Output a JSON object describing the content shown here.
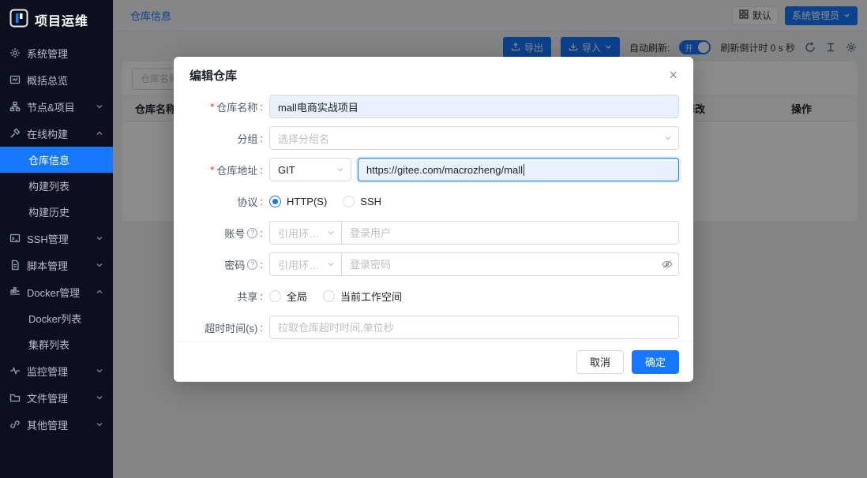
{
  "app": {
    "logo_title": "项目运维"
  },
  "sidebar": {
    "items": [
      {
        "label": "系统管理"
      },
      {
        "label": "概括总览"
      },
      {
        "label": "节点&项目"
      },
      {
        "label": "在线构建"
      },
      {
        "label": "SSH管理"
      },
      {
        "label": "脚本管理"
      },
      {
        "label": "Docker管理"
      },
      {
        "label": "监控管理"
      },
      {
        "label": "文件管理"
      },
      {
        "label": "其他管理"
      }
    ],
    "build_children": [
      {
        "label": "仓库信息"
      },
      {
        "label": "构建列表"
      },
      {
        "label": "构建历史"
      }
    ],
    "docker_children": [
      {
        "label": "Docker列表"
      },
      {
        "label": "集群列表"
      }
    ]
  },
  "header": {
    "active_tab": "仓库信息",
    "workspace_button": "默认",
    "user_button": "系统管理员"
  },
  "toolbar": {
    "export_button": "导出",
    "import_button": "导入",
    "auto_refresh_label": "自动刷新:",
    "auto_refresh_state": "开",
    "countdown_text": "刷新倒计时 0 s 秒"
  },
  "content": {
    "search_placeholder": "仓库名称",
    "table_columns": {
      "name": "仓库名称",
      "modify": "修改",
      "action": "操作"
    }
  },
  "modal": {
    "title": "编辑仓库",
    "required_mark": "*",
    "colon": ":",
    "rows": {
      "repo_name": {
        "label": "仓库名称",
        "value": "mall电商实战项目"
      },
      "group": {
        "label": "分组",
        "placeholder": "选择分组名"
      },
      "repo_url": {
        "label": "仓库地址",
        "type_value": "GIT",
        "value": "https://gitee.com/macrozheng/mall"
      },
      "protocol": {
        "label": "协议",
        "option_http": "HTTP(S)",
        "option_ssh": "SSH"
      },
      "account": {
        "label": "账号",
        "ref_placeholder": "引用环境...",
        "placeholder": "登录用户"
      },
      "password": {
        "label": "密码",
        "ref_placeholder": "引用环境...",
        "placeholder": "登录密码"
      },
      "share": {
        "label": "共享",
        "option_global": "全局",
        "option_workspace": "当前工作空间"
      },
      "timeout": {
        "label": "超时时间(s)",
        "placeholder": "拉取仓库超时时间,单位秒"
      }
    },
    "cancel_button": "取消",
    "confirm_button": "确定"
  },
  "icons": {
    "close_glyph": "×",
    "question_glyph": "?"
  },
  "colors": {
    "primary": "#1677ff",
    "sidebar_bg": "#0b0f1e",
    "filled_input_bg": "#e9f1fe",
    "mask": "rgba(0,0,0,0.45)"
  }
}
